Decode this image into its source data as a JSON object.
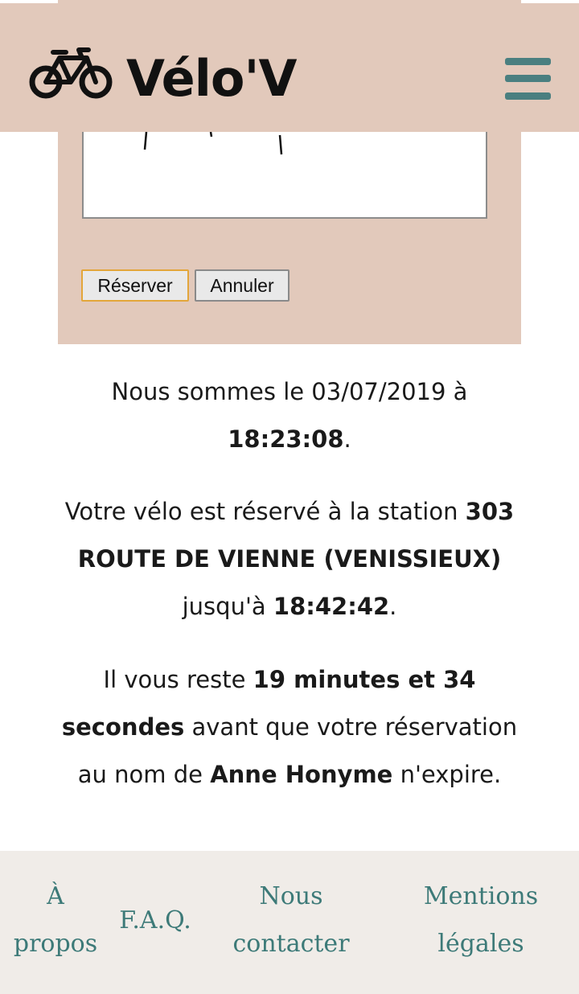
{
  "header": {
    "brand": "Vélo'V",
    "logo_icon": "bicycle-icon",
    "menu_icon": "hamburger-menu-icon"
  },
  "form": {
    "reserve_label": "Réserver",
    "cancel_label": "Annuler"
  },
  "info": {
    "date_prefix": "Nous sommes le 03/07/2019 à",
    "current_time": "18:23:08",
    "station_prefix": "Votre vélo est réservé à la station",
    "station_name": "303 ROUTE DE VIENNE (VENISSIEUX)",
    "until_prefix": "jusqu'à",
    "expiry_time": "18:42:42",
    "remaining_prefix": "Il vous reste",
    "remaining": "19 minutes et 34 secondes",
    "remaining_suffix": "avant que votre réservation au nom de",
    "holder": "Anne Honyme",
    "expire_suffix": "n'expire."
  },
  "footer": {
    "about": "À propos",
    "faq": "F.A.Q.",
    "contact": "Nous contacter",
    "legal": "Mentions légales"
  },
  "colors": {
    "panel_bg": "#e2c9bb",
    "footer_bg": "#f0ece8",
    "link": "#3d7a78",
    "menu_icon": "#4a7f80",
    "reserve_border": "#e3a63a"
  }
}
